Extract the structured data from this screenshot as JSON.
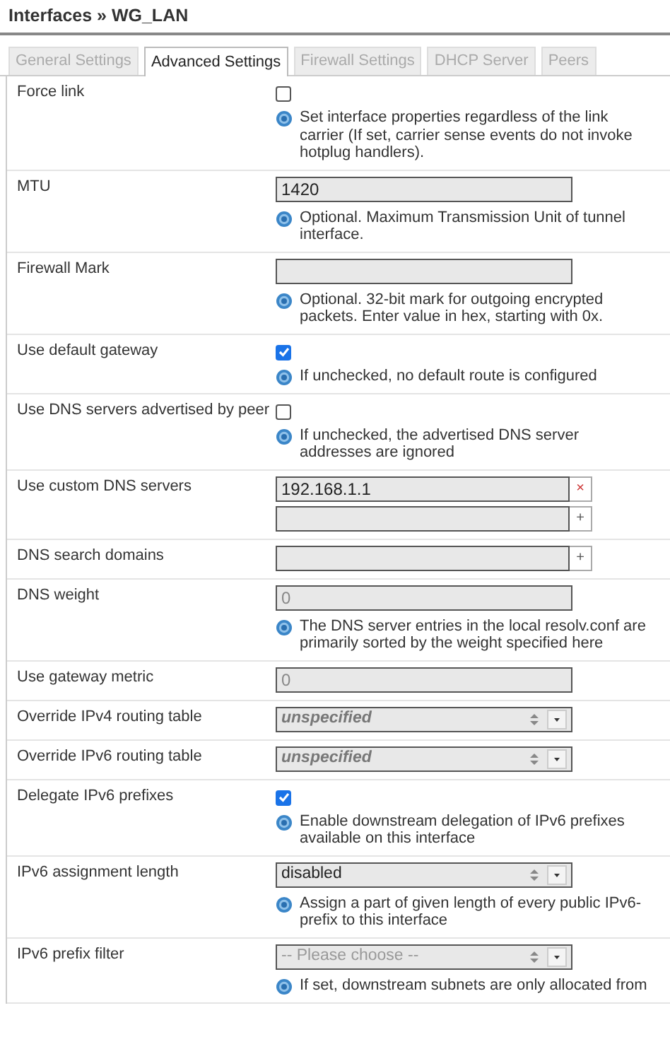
{
  "title": "Interfaces » WG_LAN",
  "tabs": [
    {
      "label": "General Settings",
      "selected": false
    },
    {
      "label": "Advanced Settings",
      "selected": true
    },
    {
      "label": "Firewall Settings",
      "selected": false
    },
    {
      "label": "DHCP Server",
      "selected": false
    },
    {
      "label": "Peers",
      "selected": false
    }
  ],
  "rows": [
    {
      "kind": "checkbox",
      "label": "Force link",
      "checked": false,
      "description": "Set interface properties regardless of the link carrier (If set, carrier sense events do not invoke hotplug handlers)."
    },
    {
      "kind": "text",
      "label": "MTU",
      "value": "1420",
      "description": "Optional. Maximum Transmission Unit of tunnel interface."
    },
    {
      "kind": "text",
      "label": "Firewall Mark",
      "description": "Optional. 32-bit mark for outgoing encrypted packets. Enter value in hex, starting with 0x."
    },
    {
      "kind": "checkbox",
      "label": "Use default gateway",
      "checked": true,
      "description": "If unchecked, no default route is configured"
    },
    {
      "kind": "checkbox",
      "label": "Use DNS servers advertised by peer",
      "checked": false,
      "description": "If unchecked, the advertised DNS server addresses are ignored"
    },
    {
      "kind": "list",
      "label": "Use custom DNS servers",
      "entries": [
        {
          "value": "192.168.1.1",
          "remove_symbol": "×"
        }
      ],
      "add_symbol": "+"
    },
    {
      "kind": "list",
      "label": "DNS search domains",
      "add_symbol": "+"
    },
    {
      "kind": "text",
      "label": "DNS weight",
      "placeholder": "0",
      "description": "The DNS server entries in the local resolv.conf are primarily sorted by the weight specified here"
    },
    {
      "kind": "text",
      "label": "Use gateway metric",
      "placeholder": "0"
    },
    {
      "kind": "select",
      "label": "Override IPv4 routing table",
      "placeholder": "unspecified"
    },
    {
      "kind": "select",
      "label": "Override IPv6 routing table",
      "placeholder": "unspecified"
    },
    {
      "kind": "checkbox",
      "label": "Delegate IPv6 prefixes",
      "checked": true,
      "description": "Enable downstream delegation of IPv6 prefixes available on this interface"
    },
    {
      "kind": "select",
      "label": "IPv6 assignment length",
      "value": "disabled",
      "description": "Assign a part of given length of every public IPv6-prefix to this interface"
    },
    {
      "kind": "select",
      "label": "IPv6 prefix filter",
      "placeholder": "-- Please choose --",
      "dim": true,
      "description": "If set, downstream subnets are only allocated from"
    }
  ]
}
